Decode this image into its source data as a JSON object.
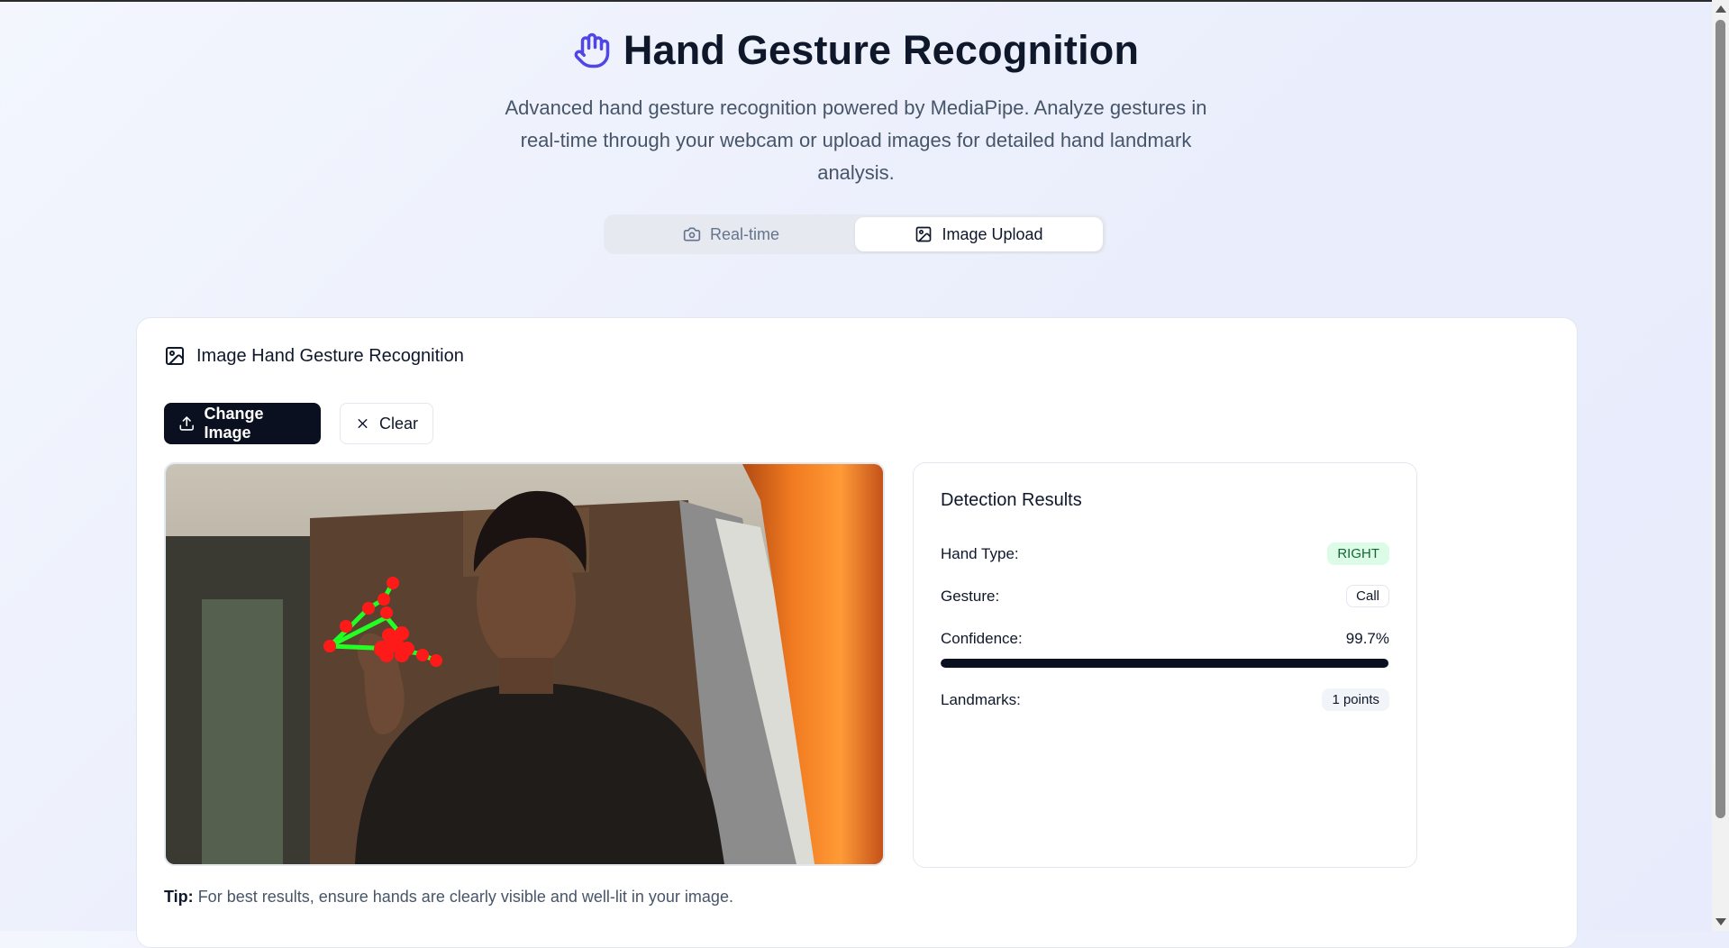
{
  "header": {
    "title": "Hand Gesture Recognition",
    "subtitle": "Advanced hand gesture recognition powered by MediaPipe. Analyze gestures in real-time through your webcam or upload images for detailed hand landmark analysis.",
    "icon": "hand-icon"
  },
  "tabs": [
    {
      "label": "Real-time",
      "icon": "camera-icon",
      "active": false
    },
    {
      "label": "Image Upload",
      "icon": "image-icon",
      "active": true
    }
  ],
  "card": {
    "title": "Image Hand Gesture Recognition",
    "change_image_label": "Change Image",
    "clear_label": "Clear",
    "tip_label": "Tip:",
    "tip_text": "For best results, ensure hands are clearly visible and well-lit in your image."
  },
  "results": {
    "title": "Detection Results",
    "hand_type_label": "Hand Type:",
    "hand_type_value": "RIGHT",
    "gesture_label": "Gesture:",
    "gesture_value": "Call",
    "confidence_label": "Confidence:",
    "confidence_value": "99.7%",
    "confidence_fraction": 0.997,
    "landmarks_label": "Landmarks:",
    "landmarks_value": "1 points"
  },
  "colors": {
    "accent": "#4f46e5",
    "primary_button": "#0b1020",
    "badge_green_bg": "#dcfce7",
    "badge_green_text": "#166534",
    "landmark_point": "#ff1a1a",
    "landmark_line": "#22ff22"
  }
}
